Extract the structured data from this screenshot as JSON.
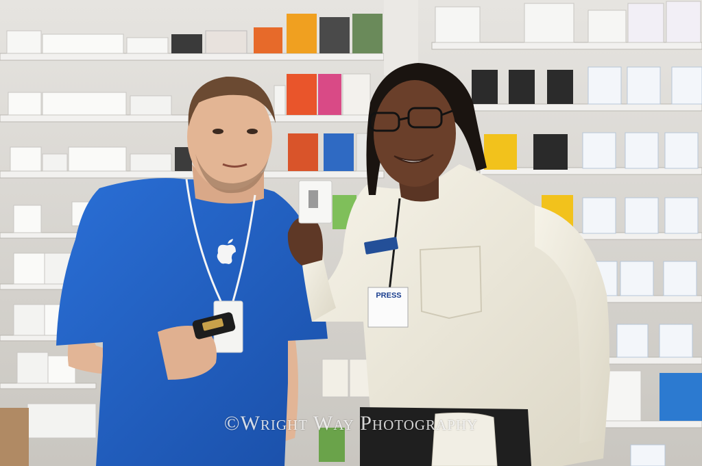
{
  "photo": {
    "watermark": "©Wright Way Photography",
    "press_badge": "PRESS"
  },
  "colors": {
    "apple_blue_shirt": "#1f5fc4",
    "white_shirt": "#f1eee2",
    "shelf": "#dcdad6"
  }
}
